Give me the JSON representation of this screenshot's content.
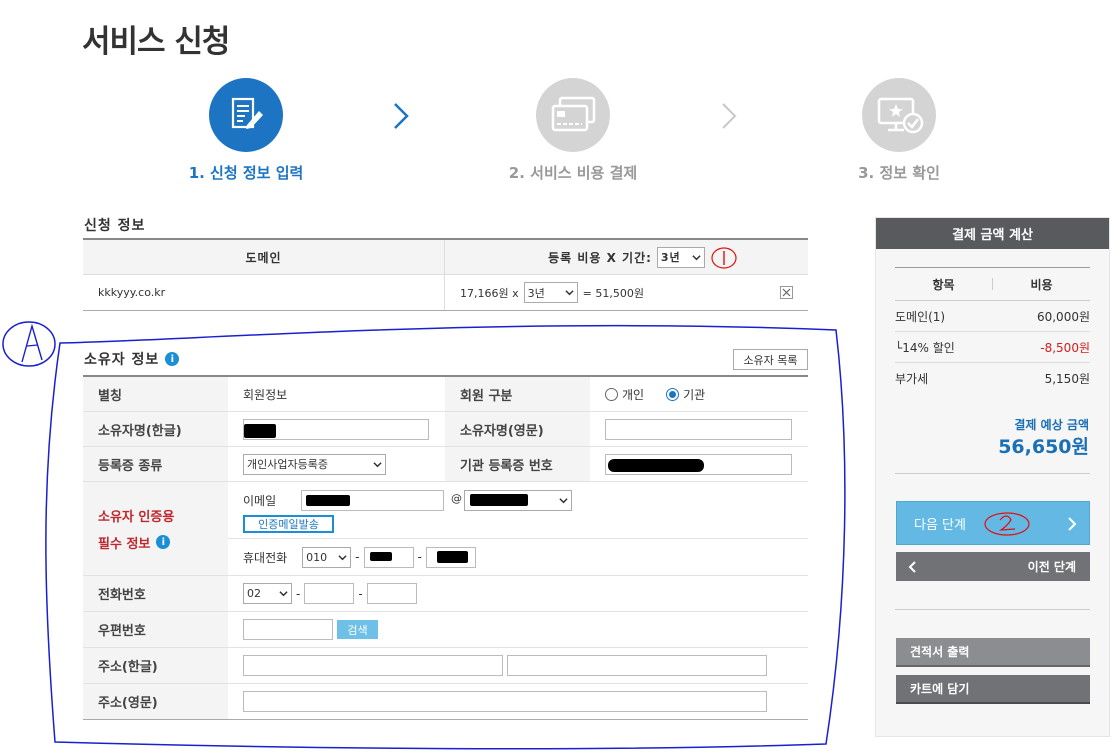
{
  "page": {
    "title": "서비스 신청"
  },
  "steps": [
    {
      "label": "1. 신청 정보 입력",
      "active": true
    },
    {
      "label": "2. 서비스 비용 결제",
      "active": false
    },
    {
      "label": "3. 정보 확인",
      "active": false
    }
  ],
  "application": {
    "title": "신청 정보",
    "col_domain": "도메인",
    "col_cost": "등록 비용 X 기간:",
    "period_header_value": "3년",
    "annotation_1": "1",
    "row": {
      "domain": "kkkyyy.co.kr",
      "price": "17,166원 x",
      "period": "3년",
      "total": "= 51,500원",
      "remove_icon": "close-icon"
    }
  },
  "owner": {
    "title": "소유자 정보",
    "list_button": "소유자 목록",
    "annotation_A": "A",
    "alias_label": "별칭",
    "alias_value": "회원정보",
    "member_type_label": "회원 구분",
    "member_type_options": [
      "개인",
      "기관"
    ],
    "member_type_selected": "기관",
    "name_kr_label": "소유자명(한글)",
    "name_en_label": "소유자명(영문)",
    "cert_type_label": "등록증 종류",
    "cert_type_value": "개인사업자등록증",
    "cert_number_label": "기관 등록증 번호",
    "auth_label_line1": "소유자 인증용",
    "auth_label_line2": "필수 정보",
    "email_label": "이메일",
    "at_sign": "@",
    "send_auth_mail_button": "인증메일발송",
    "mobile_label": "휴대전화",
    "mobile_prefix": "010",
    "dash": "-",
    "phone_label": "전화번호",
    "phone_prefix": "02",
    "zip_label": "우편번호",
    "zip_search_button": "검색",
    "address_kr_label": "주소(한글)",
    "address_en_label": "주소(영문)"
  },
  "payment": {
    "title": "결제 금액 계산",
    "col_item": "항목",
    "col_cost": "비용",
    "rows": [
      {
        "item": "도메인(1)",
        "cost": "60,000원",
        "negative": false
      },
      {
        "item": "└14% 할인",
        "cost": "-8,500원",
        "negative": true
      },
      {
        "item": "부가세",
        "cost": "5,150원",
        "negative": false
      }
    ],
    "expected_label": "결제 예상 금액",
    "expected_amount": "56,650원",
    "next_button": "다음 단계",
    "annotation_2": "2",
    "prev_button": "이전 단계",
    "quote_button": "견적서 출력",
    "cart_button": "카트에 담기"
  },
  "colors": {
    "active_blue": "#1c74c2",
    "inactive_gray": "#d4d4d4",
    "next_button": "#63b9e3",
    "annotation_pen": "#1a1fd0",
    "annotation_red": "#e01010",
    "price_red": "#d11f1f",
    "expected_blue": "#1a6fb5"
  }
}
